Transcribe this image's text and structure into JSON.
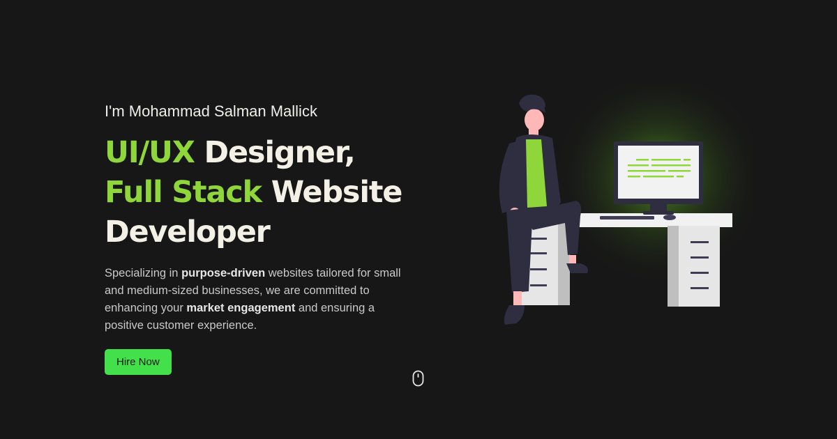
{
  "hero": {
    "intro": "I'm Mohammad Salman Mallick",
    "headline": {
      "line1_accent": "UI/UX",
      "line1_rest": " Designer,",
      "line2_accent": "Full Stack",
      "line2_rest": " Website",
      "line3": "Developer"
    },
    "description": {
      "p1": "Specializing in ",
      "b1": "purpose-driven",
      "p2": " websites tailored for small and medium-sized businesses, we are committed to enhancing your ",
      "b2": "market engagement",
      "p3": " and ensuring a positive customer experience."
    },
    "cta_label": "Hire Now"
  },
  "icons": {
    "scroll": "mouse-scroll-icon"
  },
  "colors": {
    "background": "#171717",
    "accent": "#8fd63a",
    "button": "#44e04c",
    "text": "#f3f1e6"
  }
}
